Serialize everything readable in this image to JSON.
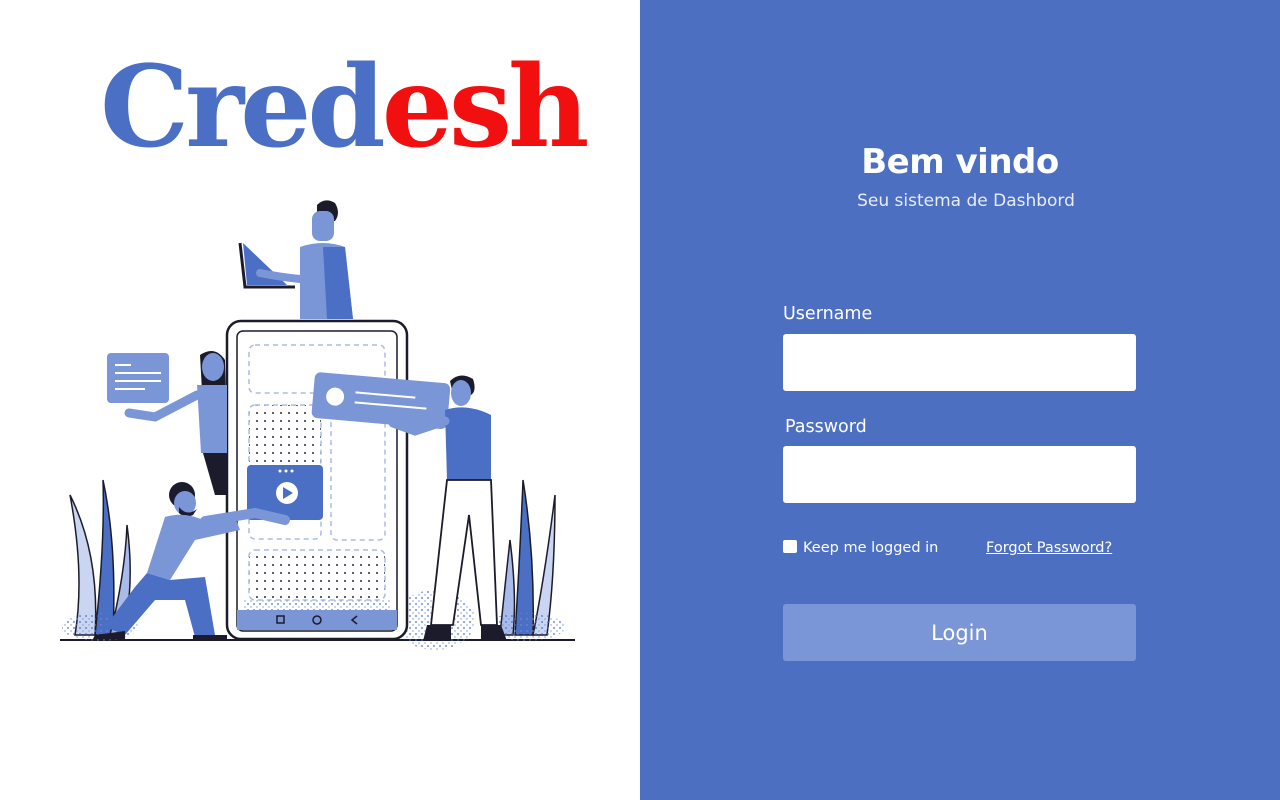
{
  "brand": {
    "part1": "Cred",
    "part2": "esh",
    "color_primary": "#4b6fc4",
    "color_accent": "#f20f0f"
  },
  "panel": {
    "background": "#4c6fc2"
  },
  "header": {
    "title": "Bem vindo",
    "subtitle": "Seu sistema de Dashbord"
  },
  "form": {
    "username_label": "Username",
    "username_value": "",
    "password_label": "Password",
    "password_value": "",
    "remember_label": "Keep me logged in",
    "remember_checked": false,
    "forgot_link": "Forgot Password?",
    "login_button": "Login"
  },
  "illustration": {
    "icon": "team-phone-illustration"
  }
}
